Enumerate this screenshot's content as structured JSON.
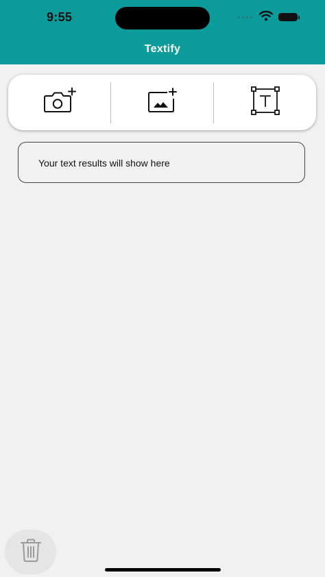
{
  "status_bar": {
    "time": "9:55",
    "icons": [
      "cellular-signal-icon",
      "wifi-icon",
      "battery-icon"
    ]
  },
  "header": {
    "title": "Textify",
    "background_color": "#0B9B9A"
  },
  "toolbar": {
    "buttons": [
      {
        "icon": "camera-add-icon"
      },
      {
        "icon": "image-add-icon"
      },
      {
        "icon": "text-recognition-icon"
      }
    ]
  },
  "results": {
    "placeholder": "Your text results will show here"
  },
  "fab": {
    "icon": "trash-icon"
  }
}
